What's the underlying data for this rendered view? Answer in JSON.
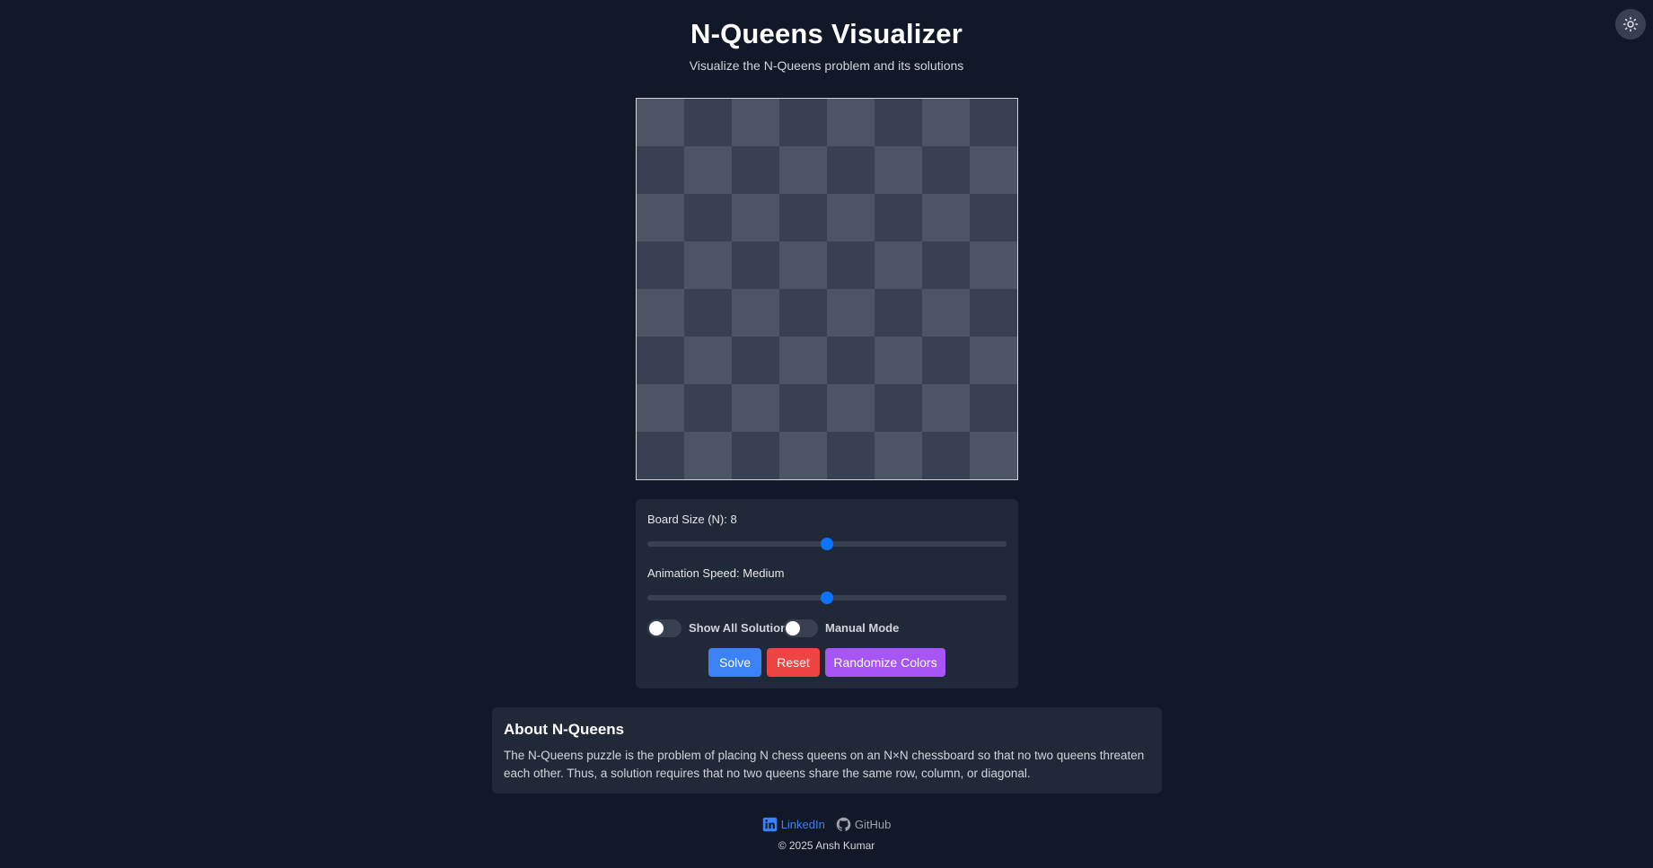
{
  "header": {
    "title": "N-Queens Visualizer",
    "subtitle": "Visualize the N-Queens problem and its solutions"
  },
  "theme_toggle": {
    "icon": "sun-icon"
  },
  "board": {
    "size": 8,
    "light_color": "#4b5563",
    "dark_color": "#374151",
    "border_color": "#d1d5db",
    "queens": []
  },
  "controls": {
    "board_size_label": "Board Size (N): 8",
    "board_size_value": 8,
    "animation_speed_label": "Animation Speed: Medium",
    "animation_speed_value": "Medium",
    "toggles": [
      {
        "label": "Show All Solutions",
        "on": false
      },
      {
        "label": "Manual Mode",
        "on": false
      }
    ],
    "buttons": [
      {
        "label": "Solve",
        "color": "#3b82f6"
      },
      {
        "label": "Reset",
        "color": "#ef4444"
      },
      {
        "label": "Randomize Colors",
        "color": "#a855f7"
      }
    ],
    "slider_thumb_color": "#0b74ff"
  },
  "about": {
    "heading": "About N-Queens",
    "text": "The N-Queens puzzle is the problem of placing N chess queens on an N×N chessboard so that no two queens threaten each other. Thus, a solution requires that no two queens share the same row, column, or diagonal."
  },
  "footer": {
    "links": [
      {
        "label": "LinkedIn",
        "icon": "linkedin-icon",
        "color": "#3b82f6"
      },
      {
        "label": "GitHub",
        "icon": "github-icon",
        "color": "#9ca3af"
      }
    ],
    "copyright": "© 2025 Ansh Kumar"
  }
}
